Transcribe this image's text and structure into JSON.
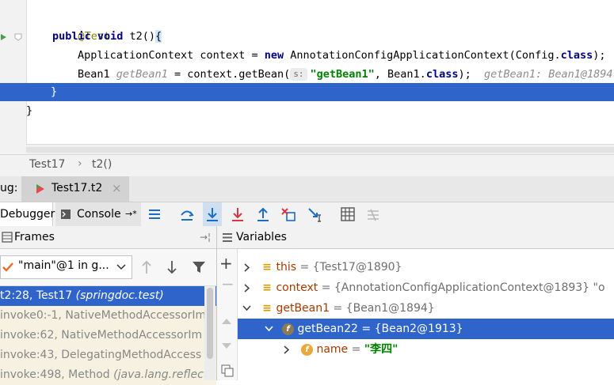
{
  "editor": {
    "line1": "@Test",
    "line2_kw": "public void",
    "line2_rest": " t2()",
    "line2_brace": "{",
    "line3_a": "ApplicationContext context = ",
    "line3_kw": "new",
    "line3_b": " AnnotationConfigApplicationContext(Config.",
    "line3_kw2": "class",
    "line3_c": ");",
    "line3_hint": "c",
    "line4_a": "Bean1 ",
    "line4_hint1": "getBean1",
    "line4_b": " = context.getBean(",
    "line4_param": "s:",
    "line4_str": "\"getBean1\"",
    "line4_c": ", Bean1.",
    "line4_kw": "class",
    "line4_d": ");",
    "line4_hint2": "getBean1: Bean1@1894",
    "line5": "}",
    "line6": "}"
  },
  "breadcrumb": {
    "class_name": "Test17",
    "separator": "›",
    "method_name": "t2()"
  },
  "debug_tabs": {
    "prefix": "ug:",
    "run_tab_label": "Test17.t2",
    "close": "×"
  },
  "toolbar": {
    "debugger_tab": "Debugger",
    "console_tab": "Console",
    "console_pin": "→*"
  },
  "frames": {
    "title": "Frames",
    "thread_selector": "\"main\"@1 in g...",
    "rows": [
      {
        "text": "t2:28, Test17 ",
        "pkg": "(springdoc.test)"
      },
      {
        "text": "invoke0:-1, NativeMethodAccessorIm",
        "pkg": ""
      },
      {
        "text": "invoke:62, NativeMethodAccessorIm",
        "pkg": ""
      },
      {
        "text": "invoke:43, DelegatingMethodAccess",
        "pkg": ""
      },
      {
        "text": "invoke:498, Method ",
        "pkg": "(java.lang.reflect"
      }
    ]
  },
  "variables": {
    "title": "Variables",
    "rows": [
      {
        "name": "this",
        "value": " = {Test17@1890}"
      },
      {
        "name": "context",
        "value": " = {AnnotationConfigApplicationContext@1893} \"o"
      },
      {
        "name": "getBean1",
        "value": " = {Bean1@1894}"
      },
      {
        "name": "getBean22",
        "value": " = {Bean2@1913}"
      },
      {
        "name": "name",
        "value": " = ",
        "str": "\"李四\""
      }
    ]
  },
  "colors": {
    "selection": "#2f65ca",
    "current_frame": "#2f65ca",
    "accent": "#1a73c9"
  }
}
